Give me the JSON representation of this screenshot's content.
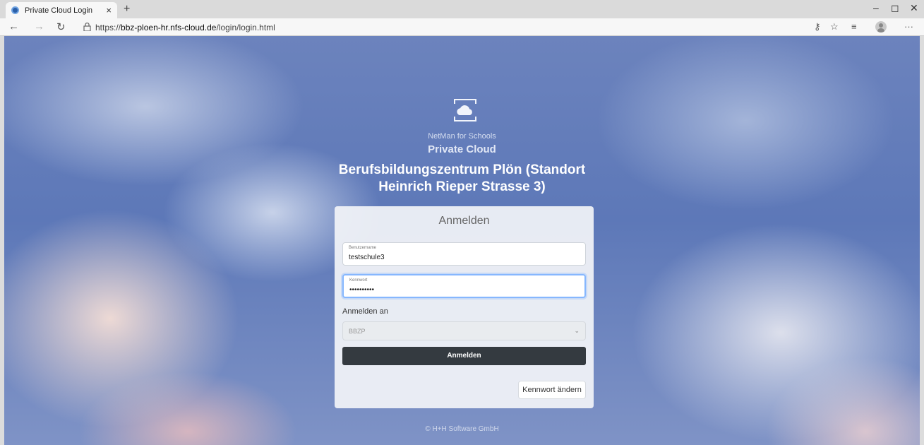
{
  "browser": {
    "tab_title": "Private Cloud Login",
    "tab_close": "×",
    "new_tab": "+",
    "url_prefix": "https://",
    "url_host": "bbz-ploen-hr.nfs-cloud.de",
    "url_path": "/login/login.html",
    "icons": [
      "back-icon",
      "forward-icon",
      "refresh-icon",
      "lock-icon",
      "key-icon",
      "favorite-star-icon",
      "favorites-list-icon",
      "profile-icon",
      "more-icon"
    ]
  },
  "page": {
    "brand_small": "NetMan for Schools",
    "brand_big": "Private Cloud",
    "school_line1": "Berufsbildungszentrum Plön (Standort",
    "school_line2": "Heinrich Rieper Strasse 3)",
    "copyright": "© H+H Software GmbH"
  },
  "login": {
    "title": "Anmelden",
    "username_label": "Benutzername",
    "username_value": "testschule3",
    "password_label": "Kennwort",
    "password_value": "••••••••••",
    "domain_label": "Anmelden an",
    "domain_value": "BBZP",
    "submit_label": "Anmelden",
    "change_password_label": "Kennwort ändern"
  }
}
